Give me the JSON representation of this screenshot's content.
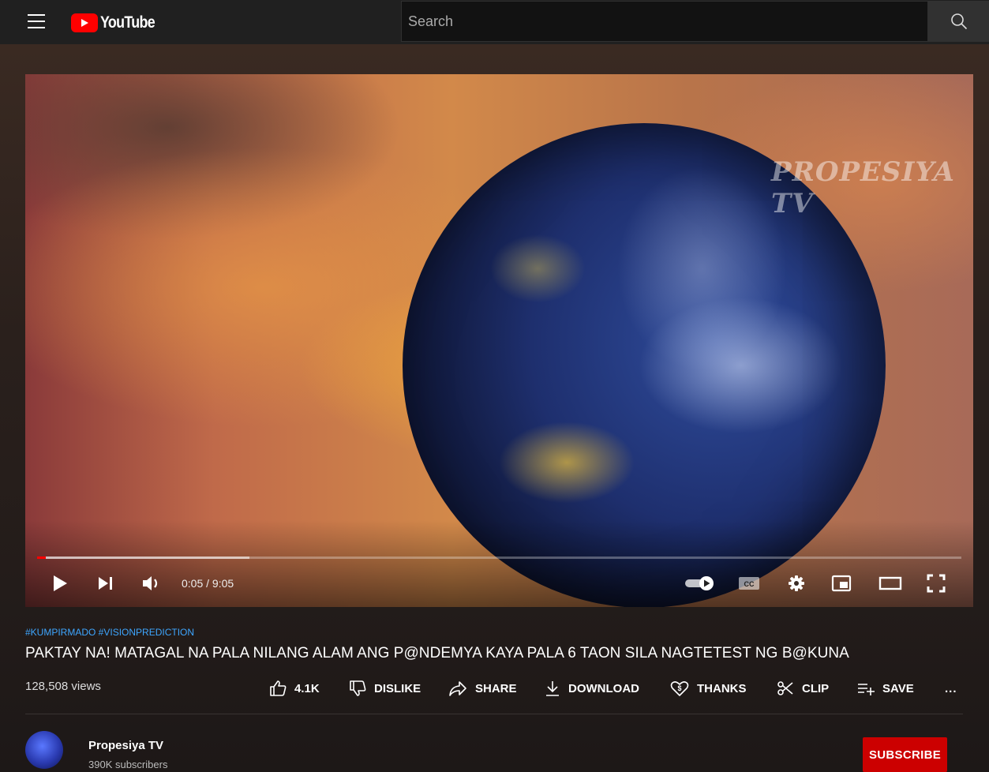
{
  "header": {
    "logo_text": "YouTube",
    "search_placeholder": "Search"
  },
  "player": {
    "watermark": "PROPESIYA TV",
    "time": "0:05 / 9:05",
    "progress_played_fraction": 0.009,
    "progress_buffered_fraction": 0.23,
    "autoplay_on": true
  },
  "video": {
    "hashtags": "#KUMPIRMADO #VISIONPREDICTION",
    "title": "PAKTAY NA! MATAGAL NA PALA NILANG ALAM ANG P@NDEMYA KAYA PALA 6 TAON SILA NAGTETEST NG B@KUNA",
    "views": "128,508 views"
  },
  "actions": {
    "like": "4.1K",
    "dislike": "DISLIKE",
    "share": "SHARE",
    "download": "DOWNLOAD",
    "thanks": "THANKS",
    "clip": "CLIP",
    "save": "SAVE",
    "more": "..."
  },
  "channel": {
    "name": "Propesiya TV",
    "subscribers": "390K subscribers",
    "subscribe_label": "SUBSCRIBE"
  },
  "colors": {
    "accent": "#ff0000",
    "subscribe": "#cc0000",
    "hashtag": "#3ea6ff"
  }
}
